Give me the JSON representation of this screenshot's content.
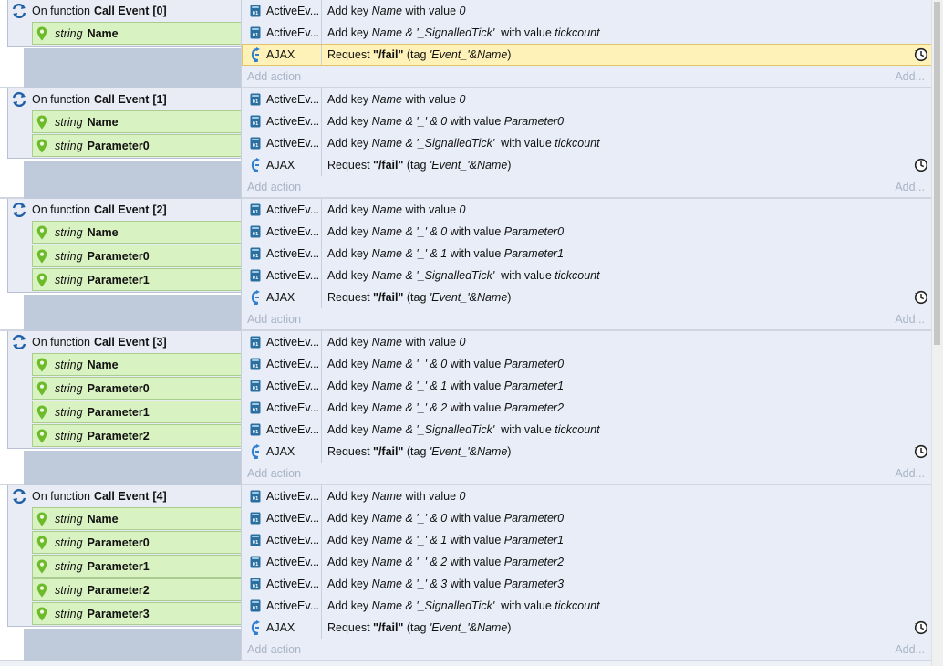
{
  "events": [
    {
      "prefix": "On function",
      "name": "Call Event",
      "index": "[0]",
      "params": [
        {
          "type": "string",
          "name": "Name"
        }
      ],
      "actions": [
        {
          "object": "ActiveEv...",
          "icon": "activeevent-icon",
          "parts": [
            [
              "Add key ",
              "n"
            ],
            [
              "Name",
              "i"
            ],
            [
              " with value ",
              "n"
            ],
            [
              "0",
              "i"
            ]
          ]
        },
        {
          "object": "ActiveEv...",
          "icon": "activeevent-icon",
          "parts": [
            [
              "Add key ",
              "n"
            ],
            [
              "Name & '_SignalledTick'",
              "i"
            ],
            [
              "  with value ",
              "n"
            ],
            [
              "tickcount",
              "i"
            ]
          ]
        },
        {
          "object": "AJAX",
          "icon": "ajax-icon",
          "clock": true,
          "highlight": true,
          "parts": [
            [
              "Request ",
              "n"
            ],
            [
              "\"/fail\"",
              "b"
            ],
            [
              " (tag ",
              "n"
            ],
            [
              "'Event_'&Name",
              "i"
            ],
            [
              ")",
              "n"
            ]
          ]
        }
      ],
      "add_label": "Add action",
      "add_short": "Add..."
    },
    {
      "prefix": "On function",
      "name": "Call Event",
      "index": "[1]",
      "params": [
        {
          "type": "string",
          "name": "Name"
        },
        {
          "type": "string",
          "name": "Parameter0"
        }
      ],
      "actions": [
        {
          "object": "ActiveEv...",
          "icon": "activeevent-icon",
          "parts": [
            [
              "Add key ",
              "n"
            ],
            [
              "Name",
              "i"
            ],
            [
              " with value ",
              "n"
            ],
            [
              "0",
              "i"
            ]
          ]
        },
        {
          "object": "ActiveEv...",
          "icon": "activeevent-icon",
          "parts": [
            [
              "Add key ",
              "n"
            ],
            [
              "Name & '_' & 0",
              "i"
            ],
            [
              " with value ",
              "n"
            ],
            [
              "Parameter0",
              "i"
            ]
          ]
        },
        {
          "object": "ActiveEv...",
          "icon": "activeevent-icon",
          "parts": [
            [
              "Add key ",
              "n"
            ],
            [
              "Name & '_SignalledTick'",
              "i"
            ],
            [
              "  with value ",
              "n"
            ],
            [
              "tickcount",
              "i"
            ]
          ]
        },
        {
          "object": "AJAX",
          "icon": "ajax-icon",
          "clock": true,
          "parts": [
            [
              "Request ",
              "n"
            ],
            [
              "\"/fail\"",
              "b"
            ],
            [
              " (tag ",
              "n"
            ],
            [
              "'Event_'&Name",
              "i"
            ],
            [
              ")",
              "n"
            ]
          ]
        }
      ],
      "add_label": "Add action",
      "add_short": "Add..."
    },
    {
      "prefix": "On function",
      "name": "Call Event",
      "index": "[2]",
      "params": [
        {
          "type": "string",
          "name": "Name"
        },
        {
          "type": "string",
          "name": "Parameter0"
        },
        {
          "type": "string",
          "name": "Parameter1"
        }
      ],
      "actions": [
        {
          "object": "ActiveEv...",
          "icon": "activeevent-icon",
          "parts": [
            [
              "Add key ",
              "n"
            ],
            [
              "Name",
              "i"
            ],
            [
              " with value ",
              "n"
            ],
            [
              "0",
              "i"
            ]
          ]
        },
        {
          "object": "ActiveEv...",
          "icon": "activeevent-icon",
          "parts": [
            [
              "Add key ",
              "n"
            ],
            [
              "Name & '_' & 0",
              "i"
            ],
            [
              " with value ",
              "n"
            ],
            [
              "Parameter0",
              "i"
            ]
          ]
        },
        {
          "object": "ActiveEv...",
          "icon": "activeevent-icon",
          "parts": [
            [
              "Add key ",
              "n"
            ],
            [
              "Name & '_' & 1",
              "i"
            ],
            [
              " with value ",
              "n"
            ],
            [
              "Parameter1",
              "i"
            ]
          ]
        },
        {
          "object": "ActiveEv...",
          "icon": "activeevent-icon",
          "parts": [
            [
              "Add key ",
              "n"
            ],
            [
              "Name & '_SignalledTick'",
              "i"
            ],
            [
              "  with value ",
              "n"
            ],
            [
              "tickcount",
              "i"
            ]
          ]
        },
        {
          "object": "AJAX",
          "icon": "ajax-icon",
          "clock": true,
          "parts": [
            [
              "Request ",
              "n"
            ],
            [
              "\"/fail\"",
              "b"
            ],
            [
              " (tag ",
              "n"
            ],
            [
              "'Event_'&Name",
              "i"
            ],
            [
              ")",
              "n"
            ]
          ]
        }
      ],
      "add_label": "Add action",
      "add_short": "Add..."
    },
    {
      "prefix": "On function",
      "name": "Call Event",
      "index": "[3]",
      "params": [
        {
          "type": "string",
          "name": "Name"
        },
        {
          "type": "string",
          "name": "Parameter0"
        },
        {
          "type": "string",
          "name": "Parameter1"
        },
        {
          "type": "string",
          "name": "Parameter2"
        }
      ],
      "actions": [
        {
          "object": "ActiveEv...",
          "icon": "activeevent-icon",
          "parts": [
            [
              "Add key ",
              "n"
            ],
            [
              "Name",
              "i"
            ],
            [
              " with value ",
              "n"
            ],
            [
              "0",
              "i"
            ]
          ]
        },
        {
          "object": "ActiveEv...",
          "icon": "activeevent-icon",
          "parts": [
            [
              "Add key ",
              "n"
            ],
            [
              "Name & '_' & 0",
              "i"
            ],
            [
              " with value ",
              "n"
            ],
            [
              "Parameter0",
              "i"
            ]
          ]
        },
        {
          "object": "ActiveEv...",
          "icon": "activeevent-icon",
          "parts": [
            [
              "Add key ",
              "n"
            ],
            [
              "Name & '_' & 1",
              "i"
            ],
            [
              " with value ",
              "n"
            ],
            [
              "Parameter1",
              "i"
            ]
          ]
        },
        {
          "object": "ActiveEv...",
          "icon": "activeevent-icon",
          "parts": [
            [
              "Add key ",
              "n"
            ],
            [
              "Name & '_' & 2",
              "i"
            ],
            [
              " with value ",
              "n"
            ],
            [
              "Parameter2",
              "i"
            ]
          ]
        },
        {
          "object": "ActiveEv...",
          "icon": "activeevent-icon",
          "parts": [
            [
              "Add key ",
              "n"
            ],
            [
              "Name & '_SignalledTick'",
              "i"
            ],
            [
              "  with value ",
              "n"
            ],
            [
              "tickcount",
              "i"
            ]
          ]
        },
        {
          "object": "AJAX",
          "icon": "ajax-icon",
          "clock": true,
          "parts": [
            [
              "Request ",
              "n"
            ],
            [
              "\"/fail\"",
              "b"
            ],
            [
              " (tag ",
              "n"
            ],
            [
              "'Event_'&Name",
              "i"
            ],
            [
              ")",
              "n"
            ]
          ]
        }
      ],
      "add_label": "Add action",
      "add_short": "Add..."
    },
    {
      "prefix": "On function",
      "name": "Call Event",
      "index": "[4]",
      "params": [
        {
          "type": "string",
          "name": "Name"
        },
        {
          "type": "string",
          "name": "Parameter0"
        },
        {
          "type": "string",
          "name": "Parameter1"
        },
        {
          "type": "string",
          "name": "Parameter2"
        },
        {
          "type": "string",
          "name": "Parameter3"
        }
      ],
      "actions": [
        {
          "object": "ActiveEv...",
          "icon": "activeevent-icon",
          "parts": [
            [
              "Add key ",
              "n"
            ],
            [
              "Name",
              "i"
            ],
            [
              " with value ",
              "n"
            ],
            [
              "0",
              "i"
            ]
          ]
        },
        {
          "object": "ActiveEv...",
          "icon": "activeevent-icon",
          "parts": [
            [
              "Add key ",
              "n"
            ],
            [
              "Name & '_' & 0",
              "i"
            ],
            [
              " with value ",
              "n"
            ],
            [
              "Parameter0",
              "i"
            ]
          ]
        },
        {
          "object": "ActiveEv...",
          "icon": "activeevent-icon",
          "parts": [
            [
              "Add key ",
              "n"
            ],
            [
              "Name & '_' & 1",
              "i"
            ],
            [
              " with value ",
              "n"
            ],
            [
              "Parameter1",
              "i"
            ]
          ]
        },
        {
          "object": "ActiveEv...",
          "icon": "activeevent-icon",
          "parts": [
            [
              "Add key ",
              "n"
            ],
            [
              "Name & '_' & 2",
              "i"
            ],
            [
              " with value ",
              "n"
            ],
            [
              "Parameter2",
              "i"
            ]
          ]
        },
        {
          "object": "ActiveEv...",
          "icon": "activeevent-icon",
          "parts": [
            [
              "Add key ",
              "n"
            ],
            [
              "Name & '_' & 3",
              "i"
            ],
            [
              " with value ",
              "n"
            ],
            [
              "Parameter3",
              "i"
            ]
          ]
        },
        {
          "object": "ActiveEv...",
          "icon": "activeevent-icon",
          "parts": [
            [
              "Add key ",
              "n"
            ],
            [
              "Name & '_SignalledTick'",
              "i"
            ],
            [
              "  with value ",
              "n"
            ],
            [
              "tickcount",
              "i"
            ]
          ]
        },
        {
          "object": "AJAX",
          "icon": "ajax-icon",
          "clock": true,
          "parts": [
            [
              "Request ",
              "n"
            ],
            [
              "\"/fail\"",
              "b"
            ],
            [
              " (tag ",
              "n"
            ],
            [
              "'Event_'&Name",
              "i"
            ],
            [
              ")",
              "n"
            ]
          ]
        }
      ],
      "add_label": "Add action",
      "add_short": "Add..."
    }
  ],
  "colors": {
    "param_bg": "#d9f2c2",
    "action_bg": "#e8edf7",
    "highlight": "#fff2b8",
    "trigger_blue": "#1f5fa8",
    "pin_green": "#6dbb2b",
    "ajax_blue": "#2e7fd0",
    "object_teal": "#2a6fa0"
  }
}
